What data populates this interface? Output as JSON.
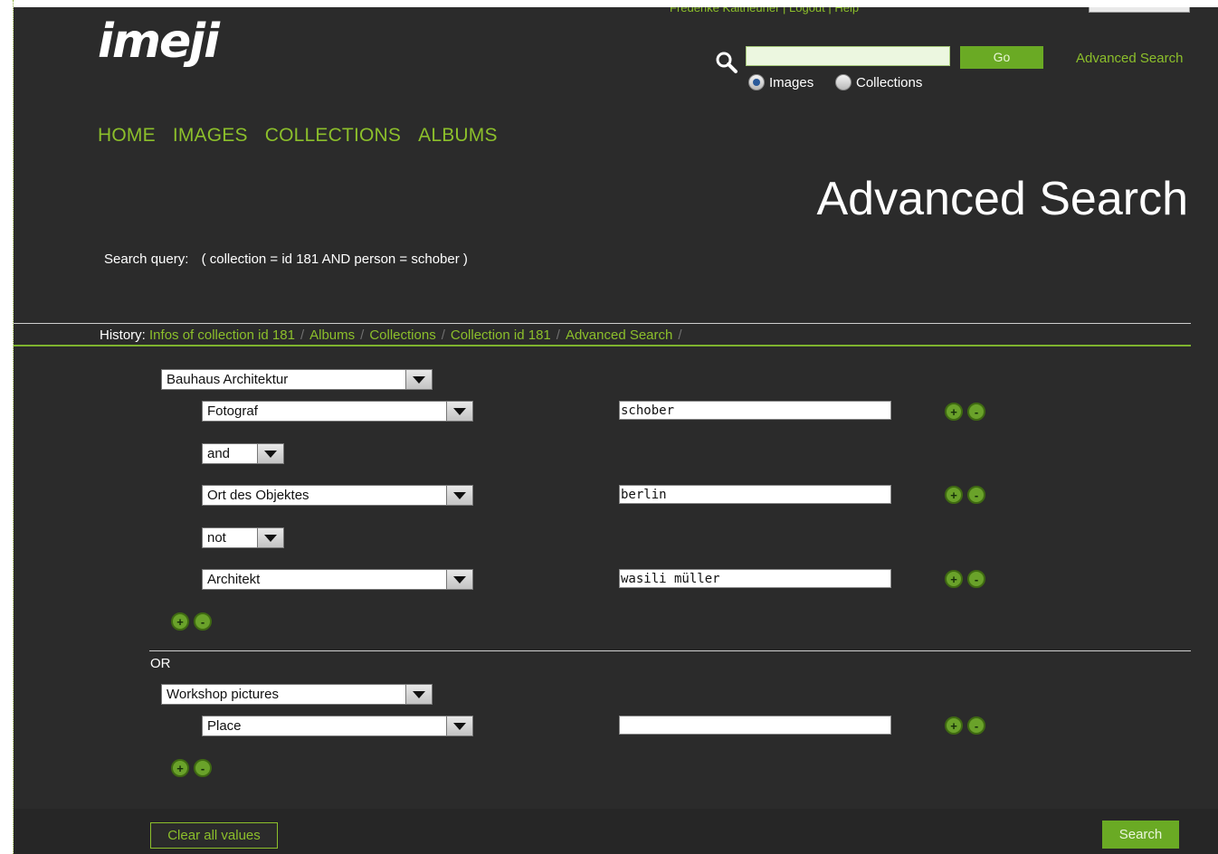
{
  "header": {
    "logo": "imeji",
    "topbar_partial": "Frederike Kaltheuner   |   Logout   |   Help",
    "quick_search": {
      "value": "",
      "go_label": "Go",
      "advanced_link": "Advanced Search",
      "options": [
        "Images",
        "Collections"
      ],
      "selected": "Images"
    }
  },
  "nav": [
    "HOME",
    "IMAGES",
    "COLLECTIONS",
    "ALBUMS"
  ],
  "page_title": "Advanced Search",
  "search_query": {
    "label": "Search query:",
    "value": "( collection = id 181 AND person = schober )"
  },
  "history": {
    "label": "History:",
    "crumbs": [
      "Infos of collection id 181",
      "Albums",
      "Collections",
      "Collection id 181",
      "Advanced Search"
    ],
    "separator": "/"
  },
  "groups": [
    {
      "collection": "Bauhaus Architektur",
      "rows": [
        {
          "field": "Fotograf",
          "value": "schober"
        },
        {
          "operator": "and"
        },
        {
          "field": "Ort des Objektes",
          "value": "berlin"
        },
        {
          "operator": "not"
        },
        {
          "field": "Architekt",
          "value": "wasili müller"
        }
      ]
    },
    {
      "collection": "Workshop pictures",
      "rows": [
        {
          "field": "Place",
          "value": ""
        }
      ]
    }
  ],
  "or_label": "OR",
  "icons": {
    "add": "+",
    "remove": "-"
  },
  "footer": {
    "clear_label": "Clear all values",
    "search_label": "Search"
  },
  "colors": {
    "accent": "#8cbf2b",
    "background": "#2b2b2b",
    "button": "#6aaa24"
  }
}
